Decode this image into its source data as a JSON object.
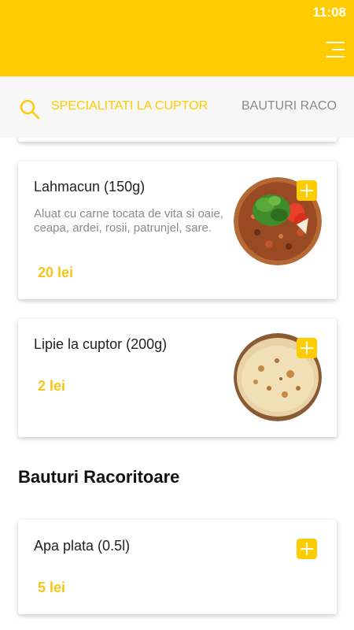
{
  "status_bar": {
    "time": "11:08"
  },
  "app_bar": {
    "menu_icon": "hamburger-menu-icon"
  },
  "colors": {
    "accent": "#ffcc00",
    "price": "#f5c518",
    "tab_inactive": "#8a8a8a",
    "tabbar_bg": "#f7f7f7"
  },
  "tabs": [
    {
      "label": "SPECIALITATI LA CUPTOR",
      "active": true
    },
    {
      "label": "BAUTURI RACO",
      "active": false
    }
  ],
  "products": [
    {
      "name": "Lahmacun (150g)",
      "description": "Aluat cu carne tocata de vita si oaie, ceapa, ardei, rosii, patrunjel, sare.",
      "price": "20 lei",
      "image": "lahmacun-image"
    },
    {
      "name": "Lipie la cuptor (200g)",
      "description": "",
      "price": "2 lei",
      "image": "flatbread-image"
    }
  ],
  "sections": [
    {
      "title": "Bauturi Racoritoare",
      "products": [
        {
          "name": "Apa plata (0.5l)",
          "price": "5 lei"
        }
      ]
    }
  ]
}
